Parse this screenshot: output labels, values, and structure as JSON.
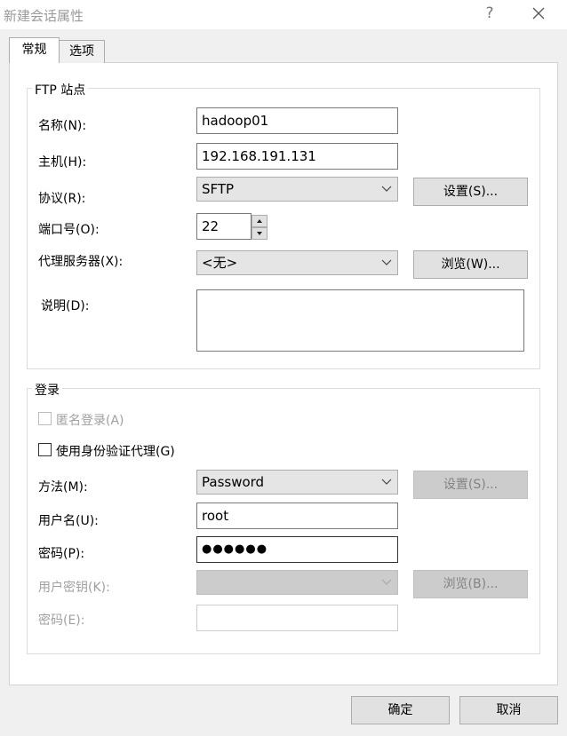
{
  "window": {
    "title": "新建会话属性",
    "help_glyph": "?"
  },
  "tabs": [
    {
      "label": "常规",
      "active": true
    },
    {
      "label": "选项",
      "active": false
    }
  ],
  "ftp_site": {
    "caption": "FTP 站点",
    "name_label": "名称(N):",
    "name_value": "hadoop01",
    "host_label": "主机(H):",
    "host_value": "192.168.191.131",
    "protocol_label": "协议(R):",
    "protocol_value": "SFTP",
    "settings_button": "设置(S)...",
    "port_label": "端口号(O):",
    "port_value": "22",
    "proxy_label": "代理服务器(X):",
    "proxy_value": "<无>",
    "browse_button": "浏览(W)...",
    "desc_label": "说明(D):",
    "desc_value": ""
  },
  "login": {
    "caption": "登录",
    "anonymous_label": "匿名登录(A)",
    "anonymous_checked": false,
    "agent_label": "使用身份验证代理(G)",
    "agent_checked": false,
    "method_label": "方法(M):",
    "method_value": "Password",
    "method_settings_button": "设置(S)...",
    "username_label": "用户名(U):",
    "username_value": "root",
    "password_label": "密码(P):",
    "password_value": "●●●●●●",
    "userkey_label": "用户密钥(K):",
    "userkey_value": "",
    "userkey_browse_button": "浏览(B)...",
    "passphrase_label": "密码(E):",
    "passphrase_value": ""
  },
  "footer": {
    "ok_button": "确定",
    "cancel_button": "取消"
  },
  "colors": {
    "window_bg": "#f0f0f0",
    "panel_bg": "#ffffff",
    "button_bg": "#e1e1e1",
    "disabled_text": "#a0a0a0"
  }
}
